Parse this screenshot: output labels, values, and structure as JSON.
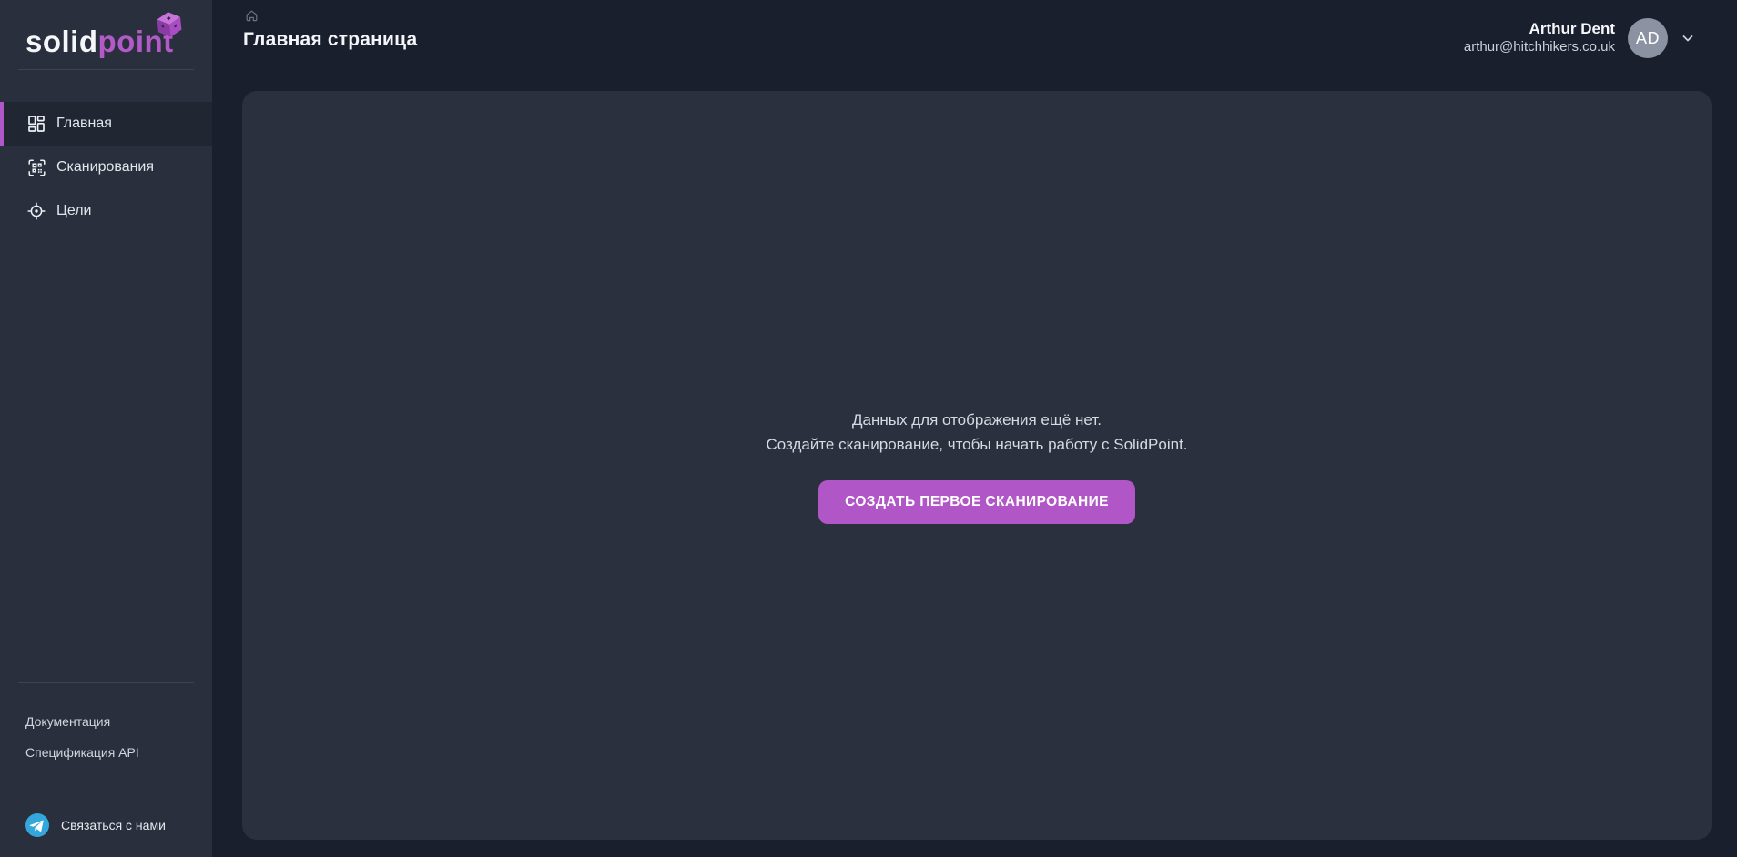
{
  "brand": {
    "logo_text_primary": "solid",
    "logo_text_secondary": "point"
  },
  "sidebar": {
    "items": [
      {
        "label": "Главная",
        "icon": "dashboard-icon",
        "active": true
      },
      {
        "label": "Сканирования",
        "icon": "qr-scan-icon",
        "active": false
      },
      {
        "label": "Цели",
        "icon": "target-icon",
        "active": false
      }
    ],
    "footer_links": [
      {
        "label": "Документация"
      },
      {
        "label": "Спецификация API"
      }
    ],
    "contact": {
      "label": "Связаться с нами",
      "icon": "telegram-icon"
    }
  },
  "header": {
    "breadcrumb_icon": "home-icon",
    "title": "Главная страница",
    "user": {
      "name": "Arthur Dent",
      "email": "arthur@hitchhikers.co.uk",
      "initials": "AD"
    }
  },
  "main": {
    "empty_state": {
      "line1": "Данных для отображения ещё нет.",
      "line2": "Создайте сканирование, чтобы начать работу с SolidPoint.",
      "button_label": "СОЗДАТЬ ПЕРВОЕ СКАНИРОВАНИЕ"
    }
  },
  "colors": {
    "page-bg": "#1a1f2d",
    "sidebar-bg": "#2a2f3d",
    "card-bg": "#2a303e",
    "active-item-bg": "#212633",
    "accent": "#b156c7",
    "telegram": "#33a6dc",
    "avatar-bg": "#8b93a3"
  }
}
